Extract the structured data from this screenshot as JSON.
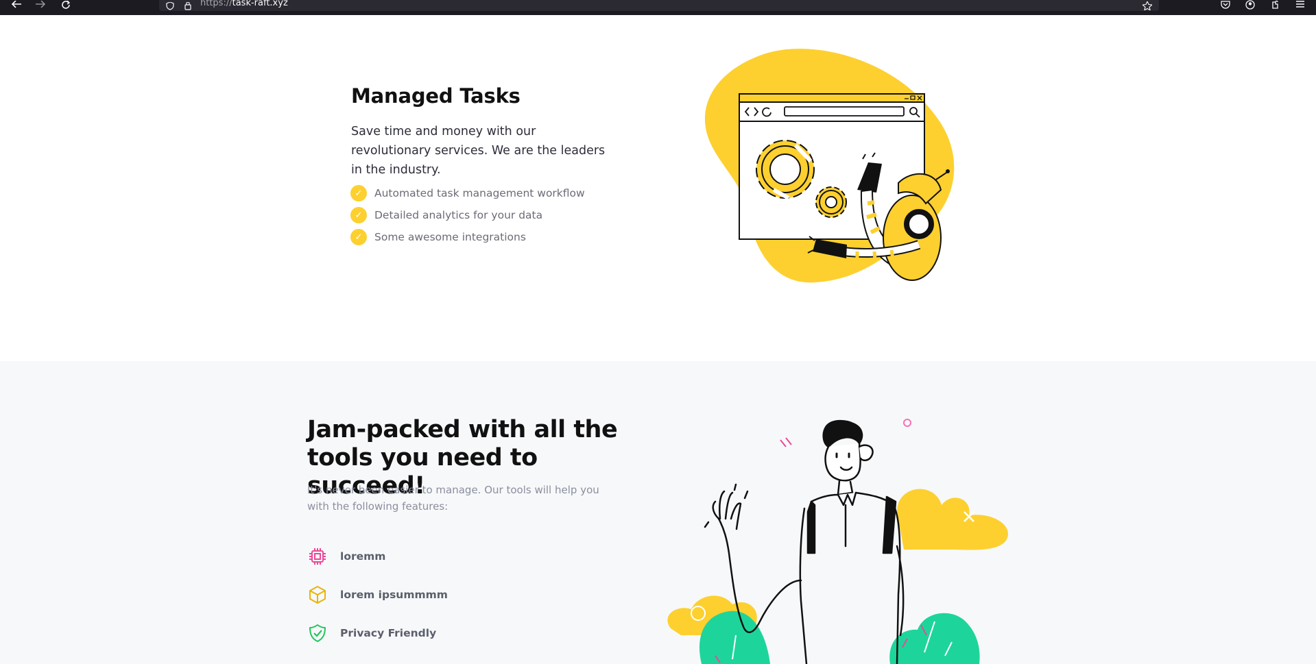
{
  "browser": {
    "url_protocol": "https://",
    "url_host": "task-raft.xyz"
  },
  "managed": {
    "title": "Managed Tasks",
    "description": "Save time and money with our revolutionary services. We are the leaders in the industry.",
    "checklist": [
      "Automated task management workflow",
      "Detailed analytics for your data",
      "Some awesome integrations"
    ],
    "check_color": "#fdd02f"
  },
  "tools": {
    "title": "Jam-packed with all the tools you need to succeed!",
    "description": "It's never been easier to manage. Our tools will help you with the following features:",
    "features": [
      {
        "label": "loremm",
        "icon": "cpu-chip-icon",
        "color": "#ec4899"
      },
      {
        "label": "lorem ipsummmm",
        "icon": "cube-icon",
        "color": "#eab308"
      },
      {
        "label": "Privacy Friendly",
        "icon": "shield-check-icon",
        "color": "#22c55e"
      }
    ]
  },
  "colors": {
    "accent_yellow": "#fdd02f",
    "accent_green": "#1dd59a",
    "section2_bg": "#f7f8fa"
  }
}
